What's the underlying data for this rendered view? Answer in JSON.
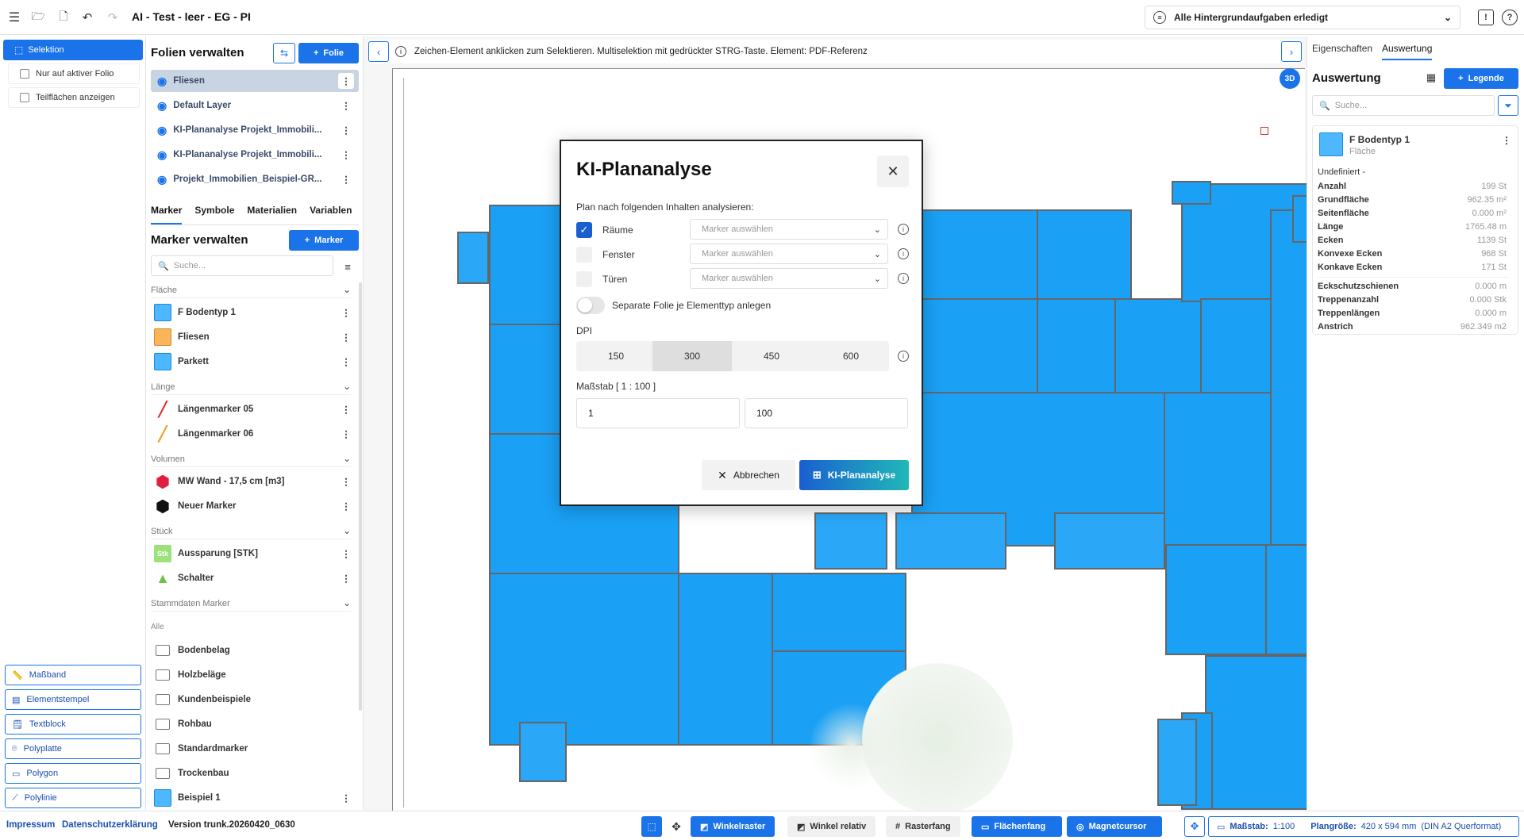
{
  "header": {
    "title": "AI - Test - leer - EG - PI",
    "background_tasks": "Alle Hintergrundaufgaben erledigt"
  },
  "tools": {
    "selection": "Selektion",
    "only_active": "Nur auf aktiver Folio",
    "show_subareas": "Teilflächen anzeigen",
    "bottom": [
      "Maßband",
      "Elementstempel",
      "Textblock",
      "Polyplatte",
      "Polygon",
      "Polylinie"
    ]
  },
  "layers": {
    "title": "Folien verwalten",
    "add_label": "Folie",
    "items": [
      "Fliesen",
      "Default Layer",
      "KI-Plananalyse Projekt_Immobili...",
      "KI-Plananalyse Projekt_Immobili...",
      "Projekt_Immobilien_Beispiel-GR..."
    ]
  },
  "marker_tabs": [
    "Marker",
    "Symbole",
    "Materialien",
    "Variablen"
  ],
  "markers": {
    "title": "Marker verwalten",
    "add_label": "Marker",
    "search_placeholder": "Suche...",
    "groups": {
      "flaeche": "Fläche",
      "laenge": "Länge",
      "volumen": "Volumen",
      "stueck": "Stück",
      "stammdaten": "Stammdaten Marker",
      "alle": "Alle"
    },
    "flaeche_items": [
      "F Bodentyp 1",
      "Fliesen",
      "Parkett"
    ],
    "laenge_items": [
      "Längenmarker 05",
      "Längenmarker 06"
    ],
    "volumen_items": [
      "MW Wand - 17,5 cm [m3]",
      "Neuer Marker"
    ],
    "stueck_items": [
      "Aussparung [STK]",
      "Schalter"
    ],
    "stueck_badge": "Stk",
    "folders": [
      "Bodenbelag",
      "Holzbeläge",
      "Kundenbeispiele",
      "Rohbau",
      "Standardmarker",
      "Trockenbau"
    ],
    "last_item": "Beispiel 1"
  },
  "canvas": {
    "hint": "Zeichen-Element anklicken zum Selektieren. Multiselektion mit gedrückter STRG-Taste. Element: PDF-Referenz",
    "badge_3d": "3D"
  },
  "modal": {
    "title": "KI-Plananalyse",
    "subtitle": "Plan nach folgenden Inhalten analysieren:",
    "rows": [
      {
        "label": "Räume",
        "checked": true,
        "select": "Marker auswählen"
      },
      {
        "label": "Fenster",
        "checked": false,
        "select": "Marker auswählen"
      },
      {
        "label": "Türen",
        "checked": false,
        "select": "Marker auswählen"
      }
    ],
    "toggle_label": "Separate Folie je Elementtyp anlegen",
    "dpi_label": "DPI",
    "dpi_options": [
      "150",
      "300",
      "450",
      "600"
    ],
    "dpi_selected": "300",
    "scale_label": "Maßstab [ 1 : 100 ]",
    "scale_left": "1",
    "scale_right": "100",
    "cancel": "Abbrechen",
    "submit": "KI-Plananalyse"
  },
  "right": {
    "tabs": [
      "Eigenschaften",
      "Auswertung"
    ],
    "title": "Auswertung",
    "legend_label": "Legende",
    "search_placeholder": "Suche...",
    "card_title": "F Bodentyp 1",
    "card_sub": "Fläche",
    "undefined": "Undefiniert -",
    "stats": [
      {
        "label": "Anzahl",
        "value": "199 St"
      },
      {
        "label": "Grundfläche",
        "value": "962.35 m²"
      },
      {
        "label": "Seitenfläche",
        "value": "0.000 m²"
      },
      {
        "label": "Länge",
        "value": "1765.48 m"
      },
      {
        "label": "Ecken",
        "value": "1139 St"
      },
      {
        "label": "Konvexe Ecken",
        "value": "968 St"
      },
      {
        "label": "Konkave Ecken",
        "value": "171 St"
      }
    ],
    "stats2": [
      {
        "label": "Eckschutzschienen",
        "value": "0.000 m"
      },
      {
        "label": "Treppenanzahl",
        "value": "0.000 Stk"
      },
      {
        "label": "Treppenlängen",
        "value": "0.000 m"
      },
      {
        "label": "Anstrich",
        "value": "962.349 m2"
      }
    ]
  },
  "footer": {
    "impressum": "Impressum",
    "datenschutz": "Datenschutzerklärung",
    "version": "Version trunk.20260420_0630",
    "buttons": [
      "Winkelraster",
      "Winkel relativ",
      "Rasterfang",
      "Flächenfang",
      "Magnetcursor"
    ],
    "scale_label": "Maßstab:",
    "scale_value": "1:100",
    "plan_size_label": "Plangröße:",
    "plan_size_value": "420 x 594 mm",
    "plan_format": "(DIN A2 Querformat)"
  },
  "colors": {
    "accent": "#1a73e8",
    "room_fill": "#1aa0f5"
  }
}
